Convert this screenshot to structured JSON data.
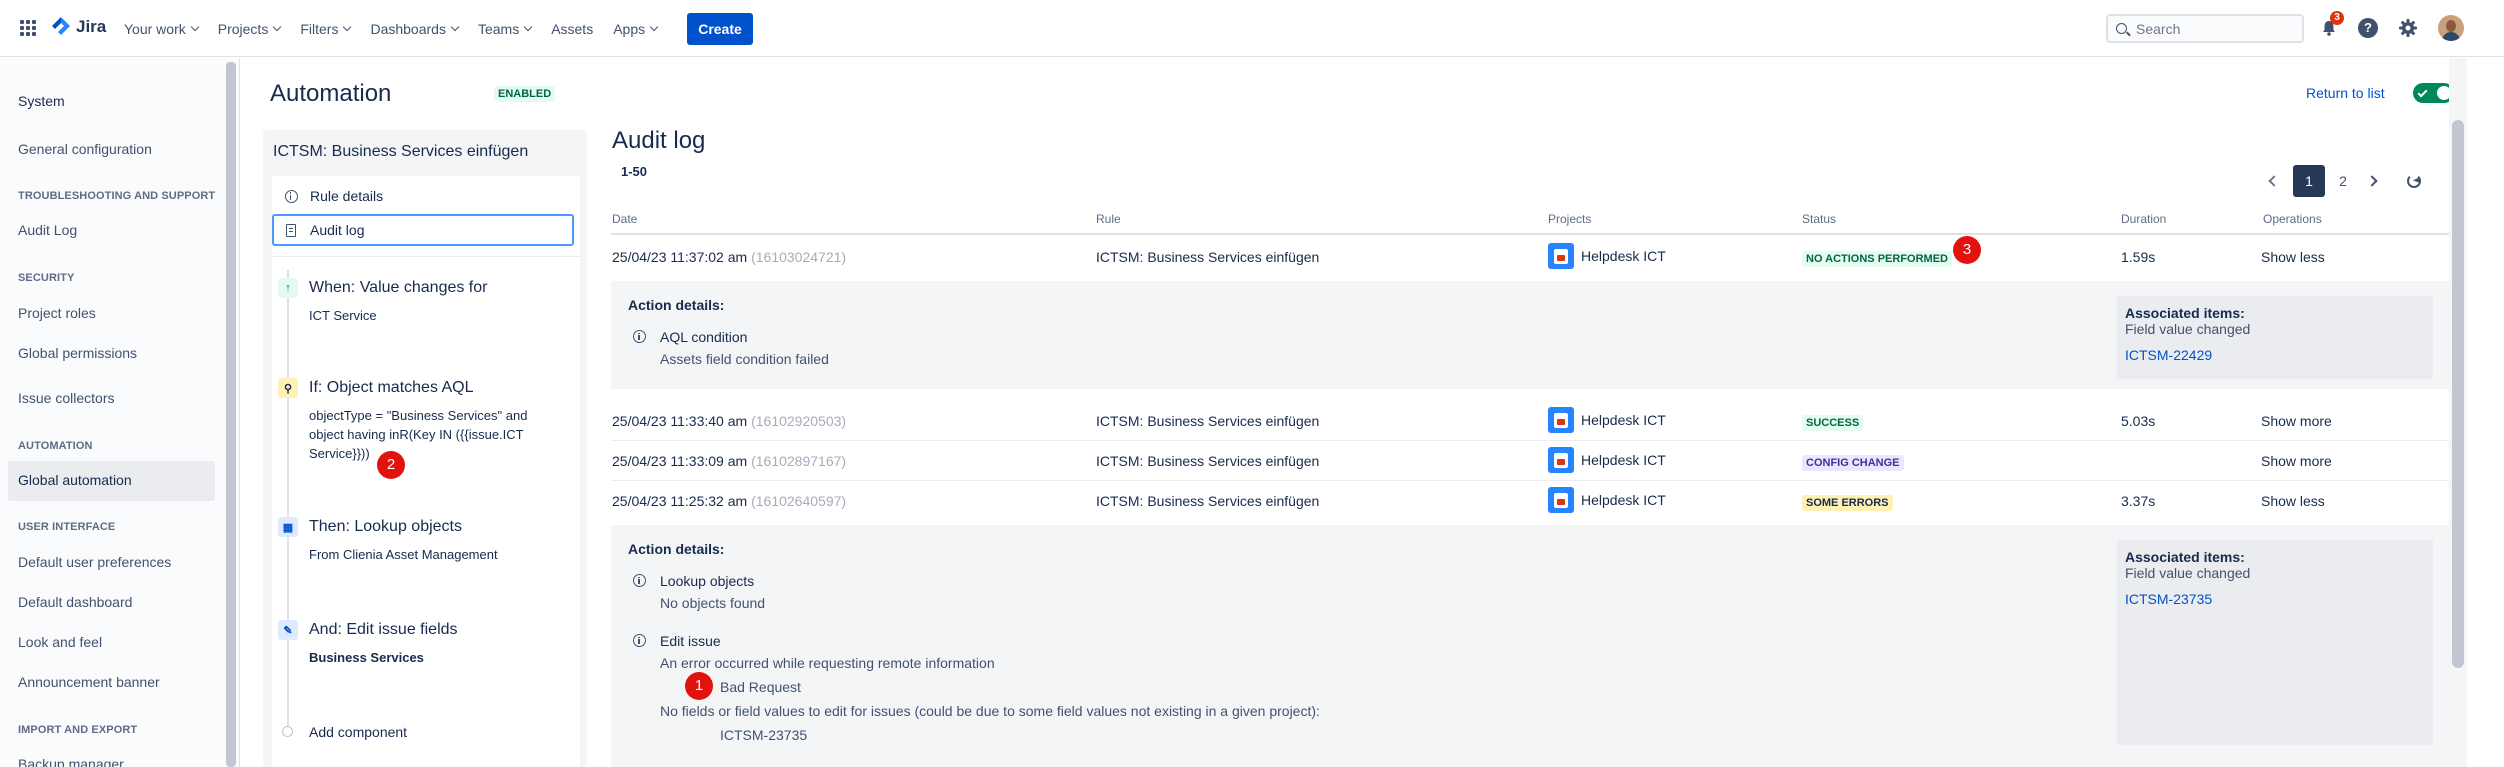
{
  "topnav": {
    "logo_text": "Jira",
    "items": [
      "Your work",
      "Projects",
      "Filters",
      "Dashboards",
      "Teams",
      "Assets",
      "Apps"
    ],
    "create_label": "Create",
    "search_placeholder": "Search",
    "notifications_count": "3"
  },
  "sidebar": {
    "system_label": "System",
    "general_configuration": "General configuration",
    "troubleshooting_heading": "TROUBLESHOOTING AND SUPPORT",
    "audit_log": "Audit Log",
    "security_heading": "SECURITY",
    "project_roles": "Project roles",
    "global_permissions": "Global permissions",
    "issue_collectors": "Issue collectors",
    "automation_heading": "AUTOMATION",
    "global_automation": "Global automation",
    "ui_heading": "USER INTERFACE",
    "default_user_preferences": "Default user preferences",
    "default_dashboard": "Default dashboard",
    "look_and_feel": "Look and feel",
    "announcement_banner": "Announcement banner",
    "import_export_heading": "IMPORT AND EXPORT",
    "backup_manager": "Backup manager"
  },
  "header": {
    "title": "Automation",
    "status": "ENABLED",
    "return_link": "Return to list"
  },
  "rule": {
    "name": "ICTSM: Business Services einfügen",
    "rule_details": "Rule details",
    "audit_log": "Audit log",
    "trigger_title": "When: Value changes for",
    "trigger_sub": "ICT Service",
    "condition_title": "If: Object matches AQL",
    "condition_sub": "objectType = \"Business Services\" and object having inR(Key IN ({{issue.ICT Service}}))",
    "action1_title": "Then: Lookup objects",
    "action1_sub": "From Clienia Asset Management",
    "action2_title": "And: Edit issue fields",
    "action2_sub": "Business Services",
    "add_component": "Add component"
  },
  "audit": {
    "title": "Audit log",
    "range": "1-50",
    "pages": [
      "1",
      "2"
    ],
    "columns": {
      "date": "Date",
      "rule": "Rule",
      "projects": "Projects",
      "status": "Status",
      "duration": "Duration",
      "operations": "Operations"
    },
    "rows": [
      {
        "date": "25/04/23 11:37:02 am",
        "id": "(16103024721)",
        "rule": "ICTSM: Business Services einfügen",
        "project": "Helpdesk ICT",
        "status": "NO ACTIONS PERFORMED",
        "duration": "1.59s",
        "op": "Show less"
      },
      {
        "date": "25/04/23 11:33:40 am",
        "id": "(16102920503)",
        "rule": "ICTSM: Business Services einfügen",
        "project": "Helpdesk ICT",
        "status": "SUCCESS",
        "duration": "5.03s",
        "op": "Show more"
      },
      {
        "date": "25/04/23 11:33:09 am",
        "id": "(16102897167)",
        "rule": "ICTSM: Business Services einfügen",
        "project": "Helpdesk ICT",
        "status": "CONFIG CHANGE",
        "duration": "",
        "op": "Show more"
      },
      {
        "date": "25/04/23 11:25:32 am",
        "id": "(16102640597)",
        "rule": "ICTSM: Business Services einfügen",
        "project": "Helpdesk ICT",
        "status": "SOME ERRORS",
        "duration": "3.37s",
        "op": "Show less"
      }
    ],
    "detail1": {
      "heading": "Action details:",
      "action_title": "AQL condition",
      "action_sub": "Assets field condition failed",
      "assoc_heading": "Associated items:",
      "assoc_sub": "Field value changed",
      "assoc_link": "ICTSM-22429"
    },
    "detail2": {
      "heading": "Action details:",
      "action1_title": "Lookup objects",
      "action1_sub": "No objects found",
      "action2_title": "Edit issue",
      "action2_sub": "An error occurred while requesting remote information",
      "error_detail": "Bad Request",
      "fields_msg": "No fields or field values to edit for issues (could be due to some field values not existing in a given project):",
      "issue_key": "ICTSM-23735",
      "assoc_heading": "Associated items:",
      "assoc_sub": "Field value changed",
      "assoc_link": "ICTSM-23735"
    }
  },
  "markers": [
    "1",
    "2",
    "3"
  ]
}
